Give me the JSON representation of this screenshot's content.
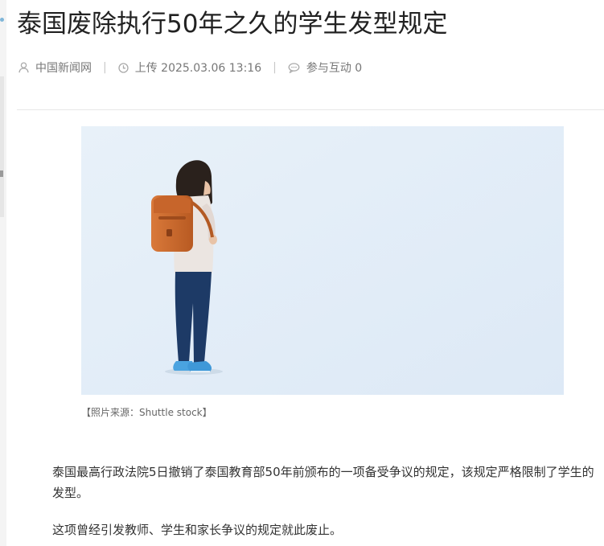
{
  "article": {
    "title": "泰国废除执行50年之久的学生发型规定",
    "meta": {
      "source": "中国新闻网",
      "uploaded": "上传 2025.03.06 13:16",
      "interaction": "参与互动 0",
      "separator": "|"
    },
    "image_caption": "【照片来源：Shuttle stock】",
    "paragraphs": [
      "泰国最高行政法院5日撤销了泰国教育部50年前颁布的一项备受争议的规定，该规定严格限制了学生的发型。",
      "这项曾经引发教师、学生和家长争议的规定就此废止。"
    ]
  },
  "icons": {
    "source": "user-icon",
    "time": "clock-icon",
    "comment": "comment-icon"
  },
  "colors": {
    "title": "#222222",
    "meta_text": "#777777",
    "body_text": "#333333",
    "photo_background": "#e3eef8",
    "backpack": "#c8692c",
    "jeans": "#1d3a66",
    "sneakers": "#4aa3e0"
  }
}
